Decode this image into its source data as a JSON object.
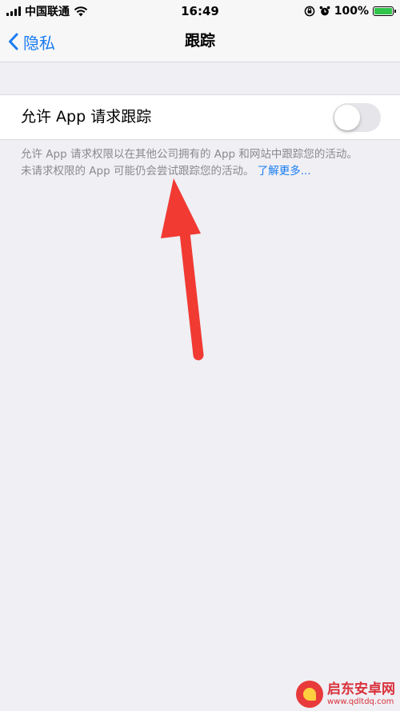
{
  "status_bar": {
    "carrier": "中国联通",
    "time": "16:49",
    "battery_percent": "100%",
    "battery_level": 1.0,
    "signal_icon": "signal-bars-icon",
    "wifi_icon": "wifi-icon",
    "lock_icon": "orientation-lock-icon",
    "alarm_icon": "alarm-clock-icon",
    "battery_icon": "battery-charging-icon"
  },
  "nav": {
    "back_label": "隐私",
    "title": "跟踪",
    "back_icon": "chevron-left-icon"
  },
  "settings": {
    "allow_tracking_label": "允许 App 请求跟踪",
    "allow_tracking_enabled": false,
    "footnote_line1": "允许 App 请求权限以在其他公司拥有的 App 和网站中跟踪您的活动。",
    "footnote_line2": "未请求权限的 App 可能仍会尝试跟踪您的活动。",
    "learn_more": "了解更多..."
  },
  "annotation": {
    "arrow_color": "#f03a32",
    "arrow_icon": "red-arrow-icon"
  },
  "watermark": {
    "name": "启东安卓网",
    "url": "www.qdltdq.com"
  },
  "colors": {
    "accent": "#1a7cf2",
    "background": "#efeff4",
    "toggle_off": "#e6e6ea"
  }
}
